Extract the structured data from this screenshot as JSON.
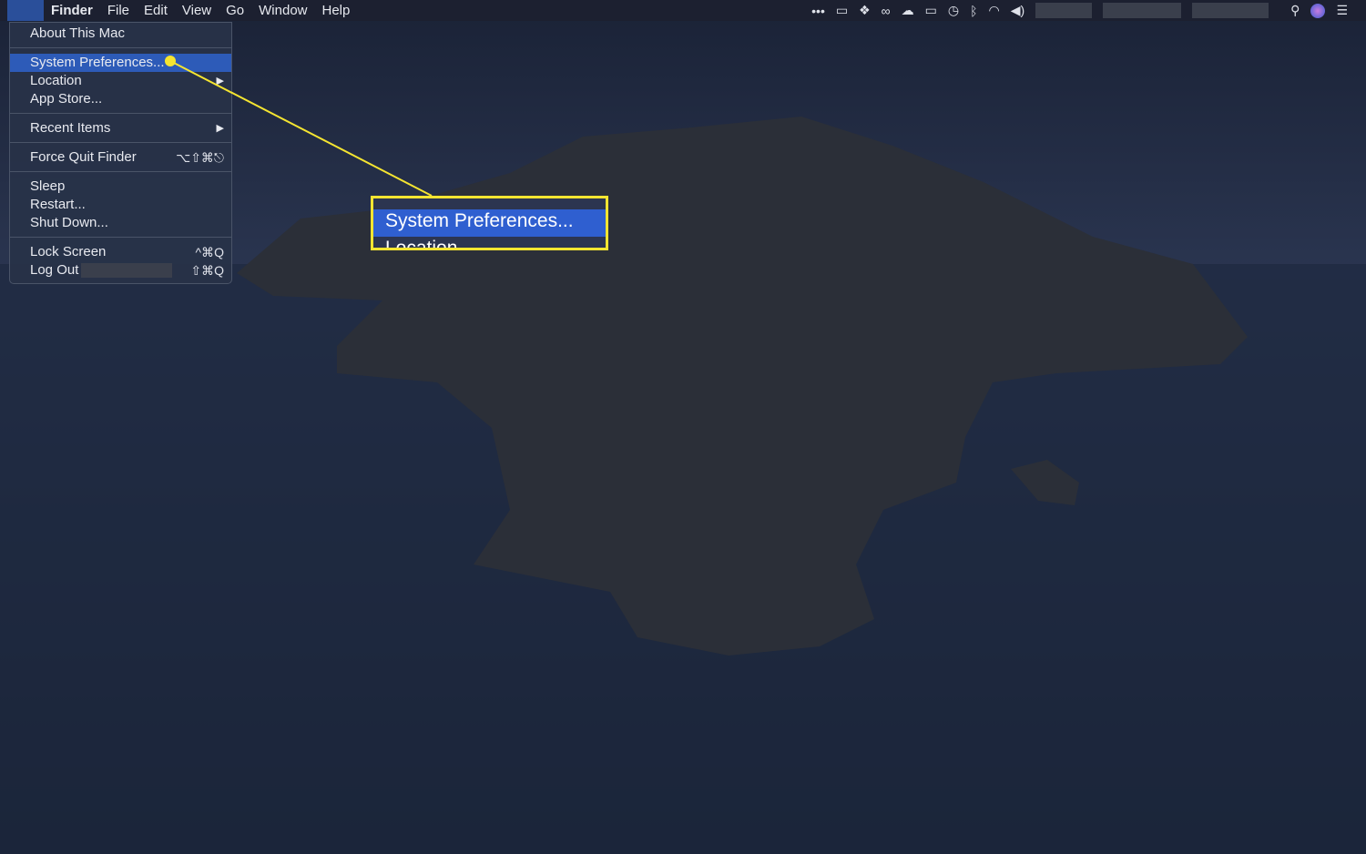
{
  "menubar": {
    "apple_icon": "apple-logo-icon",
    "items": [
      "Finder",
      "File",
      "Edit",
      "View",
      "Go",
      "Window",
      "Help"
    ],
    "status_icons": [
      "more-icon",
      "display-icon",
      "dropbox-icon",
      "creative-cloud-icon",
      "cloud-upload-icon",
      "airplay-icon",
      "time-machine-icon",
      "bluetooth-icon",
      "wifi-icon",
      "volume-icon",
      "search-icon",
      "siri-icon",
      "notification-center-icon"
    ]
  },
  "apple_menu": {
    "groups": [
      [
        {
          "label": "About This Mac"
        }
      ],
      [
        {
          "label": "System Preferences...",
          "selected": true
        },
        {
          "label": "Location",
          "submenu": true
        },
        {
          "label": "App Store..."
        }
      ],
      [
        {
          "label": "Recent Items",
          "submenu": true
        }
      ],
      [
        {
          "label": "Force Quit Finder",
          "shortcut": "⌥⇧⌘⎋"
        }
      ],
      [
        {
          "label": "Sleep"
        },
        {
          "label": "Restart..."
        },
        {
          "label": "Shut Down..."
        }
      ],
      [
        {
          "label": "Lock Screen",
          "shortcut": "^⌘Q"
        },
        {
          "label": "Log Out",
          "shortcut": "⇧⌘Q"
        }
      ]
    ]
  },
  "callout": {
    "label": "System Preferences...",
    "partial": "Location",
    "color": "#f5e531"
  },
  "colors": {
    "highlight": "#2d5bb8",
    "annotation": "#f5e531"
  }
}
